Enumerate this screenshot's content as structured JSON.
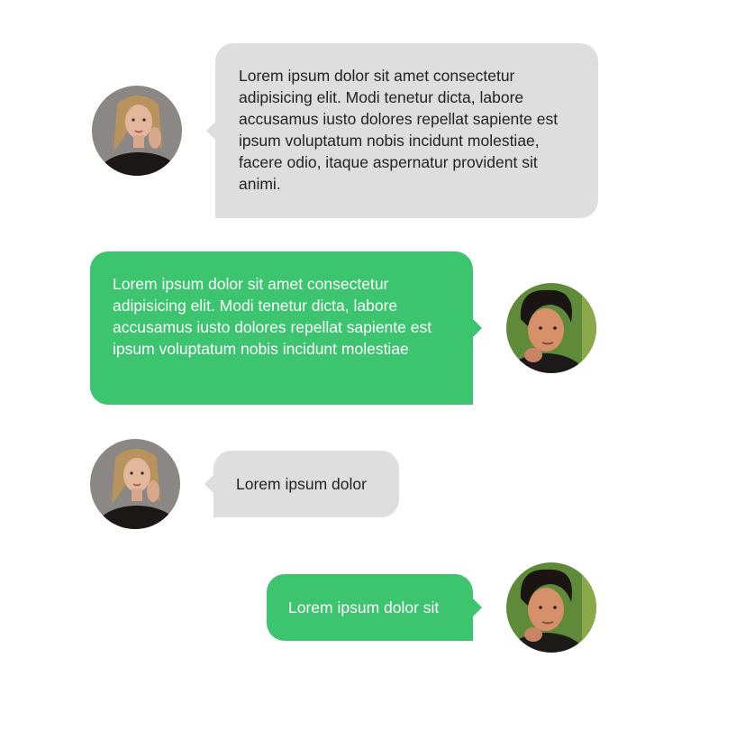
{
  "messages": [
    {
      "side": "incoming",
      "avatar": "woman-avatar",
      "text": "Lorem ipsum dolor sit amet consectetur adipisicing elit. Modi tenetur dicta, labore accusamus iusto dolores repellat sapiente est ipsum voluptatum nobis incidunt molestiae, facere odio, itaque aspernatur provident sit animi."
    },
    {
      "side": "outgoing",
      "avatar": "man-avatar",
      "text": "Lorem ipsum dolor sit amet consectetur adipisicing elit. Modi tenetur dicta, labore accusamus iusto dolores repellat sapiente est ipsum voluptatum nobis incidunt molestiae"
    },
    {
      "side": "incoming",
      "avatar": "woman-avatar",
      "text": "Lorem ipsum dolor"
    },
    {
      "side": "outgoing",
      "avatar": "man-avatar",
      "text": "Lorem ipsum dolor sit"
    }
  ],
  "colors": {
    "incoming_bubble": "#dedede",
    "incoming_text": "#222222",
    "outgoing_bubble": "#3cc46f",
    "outgoing_text": "#ffffff"
  }
}
